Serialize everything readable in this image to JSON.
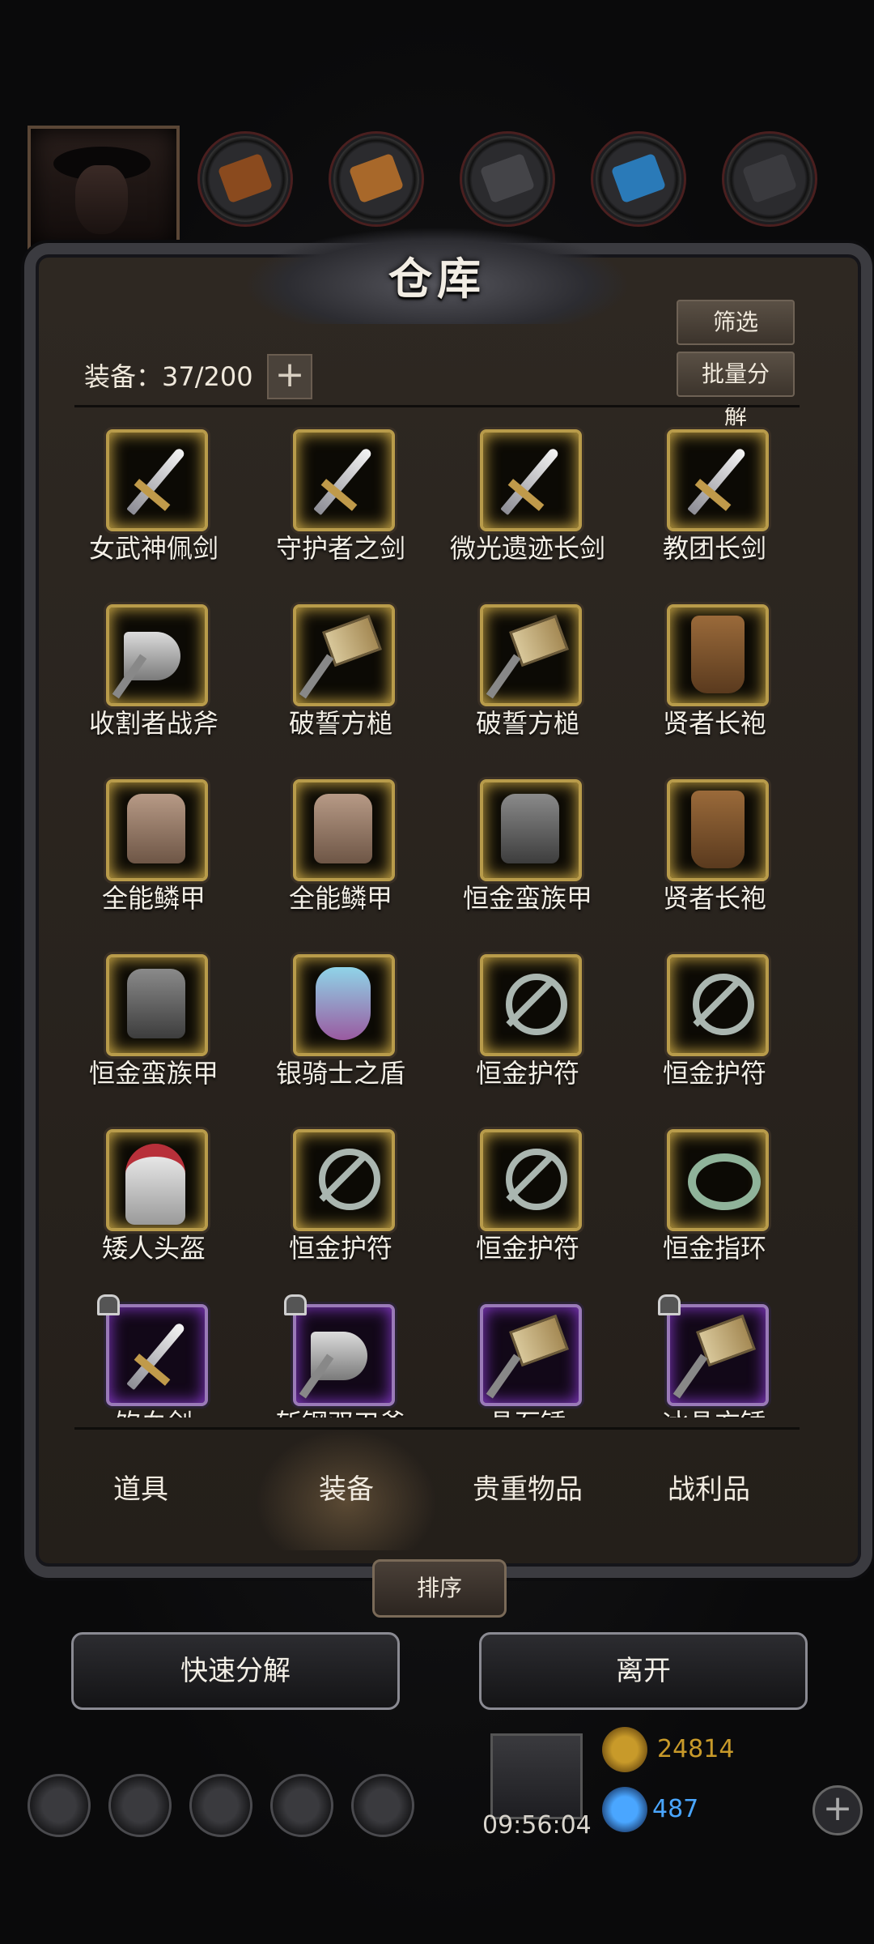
{
  "title": "仓库",
  "capacity": {
    "label": "装备：37/200",
    "add": "+"
  },
  "buttons": {
    "filter": "筛选",
    "bulk_decompose": "批量分解",
    "sort": "排序",
    "quick_decompose": "快速分解",
    "leave": "离开"
  },
  "items": [
    {
      "name": "女武神佩剑",
      "icon": "sword-icon",
      "rarity": "gold"
    },
    {
      "name": "守护者之剑",
      "icon": "sword-icon",
      "rarity": "gold"
    },
    {
      "name": "微光遗迹长剑",
      "icon": "sword-icon",
      "rarity": "gold"
    },
    {
      "name": "教团长剑",
      "icon": "sword-icon",
      "rarity": "gold"
    },
    {
      "name": "收割者战斧",
      "icon": "axe-icon",
      "rarity": "gold"
    },
    {
      "name": "破誓方槌",
      "icon": "hammer-icon",
      "rarity": "gold"
    },
    {
      "name": "破誓方槌",
      "icon": "hammer-icon",
      "rarity": "gold"
    },
    {
      "name": "贤者长袍",
      "icon": "robe-icon",
      "rarity": "gold"
    },
    {
      "name": "全能鳞甲",
      "icon": "armor-icon",
      "rarity": "gold"
    },
    {
      "name": "全能鳞甲",
      "icon": "armor-icon",
      "rarity": "gold"
    },
    {
      "name": "恒金蛮族甲",
      "icon": "armor-icon",
      "rarity": "gold"
    },
    {
      "name": "贤者长袍",
      "icon": "robe-icon",
      "rarity": "gold"
    },
    {
      "name": "恒金蛮族甲",
      "icon": "armor-icon",
      "rarity": "gold"
    },
    {
      "name": "银骑士之盾",
      "icon": "shield-icon",
      "rarity": "gold"
    },
    {
      "name": "恒金护符",
      "icon": "amulet-icon",
      "rarity": "gold"
    },
    {
      "name": "恒金护符",
      "icon": "amulet-icon",
      "rarity": "gold"
    },
    {
      "name": "矮人头盔",
      "icon": "helmet-icon",
      "rarity": "gold"
    },
    {
      "name": "恒金护符",
      "icon": "amulet-icon",
      "rarity": "gold"
    },
    {
      "name": "恒金护符",
      "icon": "amulet-icon",
      "rarity": "gold"
    },
    {
      "name": "恒金指环",
      "icon": "ring-icon",
      "rarity": "gold"
    },
    {
      "name": "饮血剑",
      "icon": "sword-icon",
      "rarity": "purple",
      "locked": true
    },
    {
      "name": "斩钢双刃斧",
      "icon": "axe-icon",
      "rarity": "purple",
      "locked": true
    },
    {
      "name": "晶石锤",
      "icon": "hammer-icon",
      "rarity": "purple",
      "locked": false
    },
    {
      "name": "冰晶方锤",
      "icon": "hammer-icon",
      "rarity": "purple",
      "locked": true
    }
  ],
  "tabs": [
    {
      "label": "道具",
      "active": false
    },
    {
      "label": "装备",
      "active": true
    },
    {
      "label": "贵重物品",
      "active": false
    },
    {
      "label": "战利品",
      "active": false
    }
  ],
  "resources_top": [
    {
      "icon": "leather-icon",
      "color": "#8a4a1e"
    },
    {
      "icon": "wood-icon",
      "color": "#a8682a"
    },
    {
      "icon": "iron-icon",
      "color": "#444448"
    },
    {
      "icon": "crystal-icon",
      "color": "#2a7ab8"
    },
    {
      "icon": "steel-icon",
      "color": "#3a3a3e"
    }
  ],
  "hud": {
    "timer": "09:56:04",
    "gold": "24814",
    "gems": "487",
    "gold_color": "#c89a2a",
    "gem_color": "#4aa6ff"
  }
}
